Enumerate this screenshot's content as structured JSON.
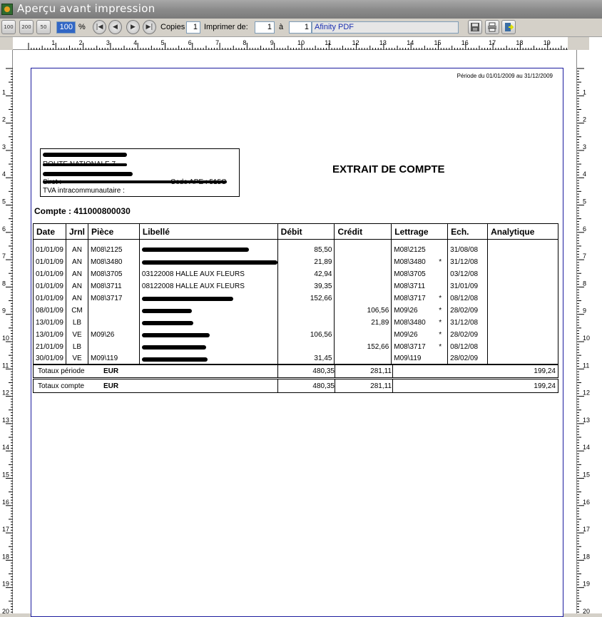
{
  "window": {
    "title": "Aperçu avant impression"
  },
  "toolbar": {
    "zoom_buttons": [
      "100",
      "200",
      "50"
    ],
    "zoom_value": "100",
    "zoom_unit": "%",
    "copies_label": "Copies",
    "copies_value": "1",
    "print_from_label": "Imprimer de:",
    "print_from_value": "1",
    "to_label": "à",
    "to_value": "1",
    "printer": "Afinity PDF"
  },
  "ruler": {
    "h_numbers": [
      "1",
      "2",
      "3",
      "4",
      "5",
      "6",
      "7",
      "8",
      "9",
      "10",
      "11",
      "12",
      "13",
      "14",
      "15",
      "16",
      "17",
      "18",
      "19",
      "20"
    ],
    "v_numbers": [
      "1",
      "2",
      "3",
      "4",
      "5",
      "6",
      "7",
      "8",
      "9",
      "10",
      "11",
      "12",
      "13",
      "14",
      "15",
      "16",
      "17",
      "18",
      "19",
      "20"
    ]
  },
  "report": {
    "period": "Période du 01/01/2009 au 31/12/2009",
    "title": "EXTRAIT DE COMPTE",
    "address": {
      "line2": "ROUTE NATIONALE 7",
      "line4_prefix": "Siret :",
      "line4_suffix": "Code APE : 515C",
      "tva": "TVA intracommunautaire :"
    },
    "account": "Compte : 411000800030",
    "columns": [
      "Date",
      "Jrnl",
      "Pièce",
      "Libellé",
      "Débit",
      "Crédit",
      "Lettrage",
      "Ech.",
      "Analytique"
    ],
    "rows": [
      {
        "date": "01/01/09",
        "jrnl": "AN",
        "piece": "M08\\2125",
        "libelle": "",
        "debit": "85,50",
        "credit": "",
        "lettrage": "M08\\2125",
        "star": "",
        "ech": "31/08/08"
      },
      {
        "date": "01/01/09",
        "jrnl": "AN",
        "piece": "M08\\3480",
        "libelle": "",
        "debit": "21,89",
        "credit": "",
        "lettrage": "M08\\3480",
        "star": "*",
        "ech": "31/12/08"
      },
      {
        "date": "01/01/09",
        "jrnl": "AN",
        "piece": "M08\\3705",
        "libelle": "03122008 HALLE AUX FLEURS",
        "debit": "42,94",
        "credit": "",
        "lettrage": "M08\\3705",
        "star": "",
        "ech": "03/12/08"
      },
      {
        "date": "01/01/09",
        "jrnl": "AN",
        "piece": "M08\\3711",
        "libelle": "08122008 HALLE AUX FLEURS",
        "debit": "39,35",
        "credit": "",
        "lettrage": "M08\\3711",
        "star": "",
        "ech": "31/01/09"
      },
      {
        "date": "01/01/09",
        "jrnl": "AN",
        "piece": "M08\\3717",
        "libelle": "",
        "debit": "152,66",
        "credit": "",
        "lettrage": "M08\\3717",
        "star": "*",
        "ech": "08/12/08"
      },
      {
        "date": "08/01/09",
        "jrnl": "CM",
        "piece": "",
        "libelle": "",
        "debit": "",
        "credit": "106,56",
        "lettrage": "M09\\26",
        "star": "*",
        "ech": "28/02/09"
      },
      {
        "date": "13/01/09",
        "jrnl": "LB",
        "piece": "",
        "libelle": "",
        "debit": "",
        "credit": "21,89",
        "lettrage": "M08\\3480",
        "star": "*",
        "ech": "31/12/08"
      },
      {
        "date": "13/01/09",
        "jrnl": "VE",
        "piece": "M09\\26",
        "libelle": "",
        "debit": "106,56",
        "credit": "",
        "lettrage": "M09\\26",
        "star": "*",
        "ech": "28/02/09"
      },
      {
        "date": "21/01/09",
        "jrnl": "LB",
        "piece": "",
        "libelle": "",
        "debit": "",
        "credit": "152,66",
        "lettrage": "M08\\3717",
        "star": "*",
        "ech": "08/12/08"
      },
      {
        "date": "30/01/09",
        "jrnl": "VE",
        "piece": "M09\\119",
        "libelle": "",
        "debit": "31,45",
        "credit": "",
        "lettrage": "M09\\119",
        "star": "",
        "ech": "28/02/09"
      }
    ],
    "totals_period": {
      "label": "Totaux période",
      "currency": "EUR",
      "debit": "480,35",
      "credit": "281,11",
      "solde": "199,24"
    },
    "totals_account": {
      "label": "Totaux compte",
      "currency": "EUR",
      "debit": "480,35",
      "credit": "281,11",
      "solde": "199,24"
    }
  }
}
